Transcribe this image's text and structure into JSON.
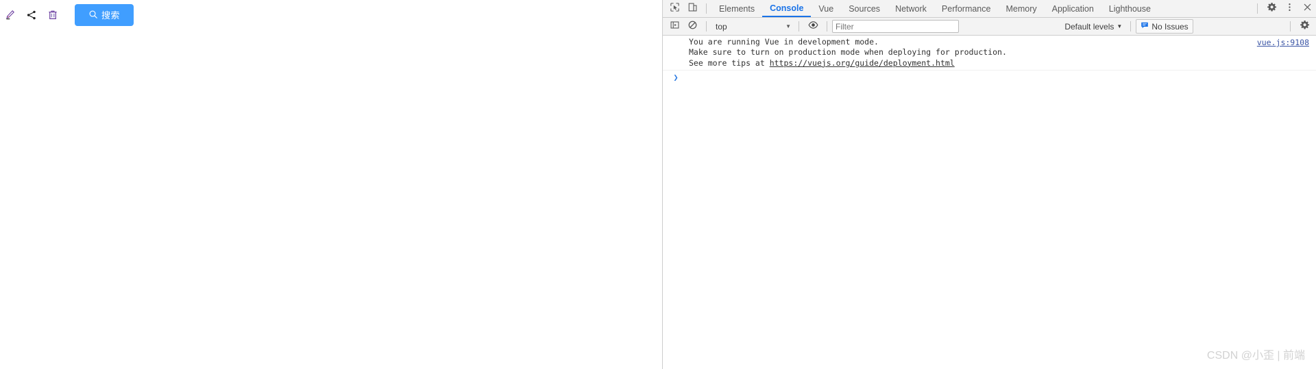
{
  "app": {
    "toolbar": {
      "icons": [
        {
          "name": "edit-pencil-icon",
          "title": "编辑"
        },
        {
          "name": "share-icon",
          "title": "分享"
        },
        {
          "name": "trash-delete-icon",
          "title": "删除"
        }
      ],
      "search_button": {
        "label": "搜索",
        "icon": "search-icon",
        "color": "#409eff",
        "text_color": "#ffffff"
      }
    }
  },
  "devtools": {
    "tabbar": {
      "left_icons": [
        {
          "name": "inspect-element-icon"
        },
        {
          "name": "toggle-device-toolbar-icon"
        }
      ],
      "tabs": [
        {
          "label": "Elements",
          "selected": false
        },
        {
          "label": "Console",
          "selected": true
        },
        {
          "label": "Vue",
          "selected": false
        },
        {
          "label": "Sources",
          "selected": false
        },
        {
          "label": "Network",
          "selected": false
        },
        {
          "label": "Performance",
          "selected": false
        },
        {
          "label": "Memory",
          "selected": false
        },
        {
          "label": "Application",
          "selected": false
        },
        {
          "label": "Lighthouse",
          "selected": false
        }
      ],
      "right_icons": [
        {
          "name": "settings-gear-icon"
        },
        {
          "name": "more-options-kebab-icon"
        },
        {
          "name": "close-devtools-icon"
        }
      ],
      "accent_color": "#1a73e8"
    },
    "console_toolbar": {
      "sidebar_toggle_icon": "console-sidebar-toggle-icon",
      "clear_console_icon": "clear-console-icon",
      "context": {
        "value": "top",
        "caret": "▼"
      },
      "eye_icon": "live-expression-eye-icon",
      "filter": {
        "placeholder": "Filter",
        "value": ""
      },
      "levels": {
        "label": "Default levels",
        "caret": "▼"
      },
      "issues": {
        "label": "No Issues",
        "icon": "issues-message-icon",
        "color": "#1a73e8"
      },
      "settings_icon": "console-settings-gear-icon"
    },
    "console_messages": [
      {
        "lines": [
          {
            "text": "You are running Vue in development mode.",
            "link": null
          },
          {
            "text": "Make sure to turn on production mode when deploying for production.",
            "link": null
          },
          {
            "text": "See more tips at ",
            "link": "https://vuejs.org/guide/deployment.html"
          }
        ],
        "source": "vue.js:9108"
      }
    ],
    "prompt": {
      "arrow": "❯",
      "value": ""
    }
  },
  "watermark": {
    "text": "CSDN @小歪 | 前端"
  }
}
